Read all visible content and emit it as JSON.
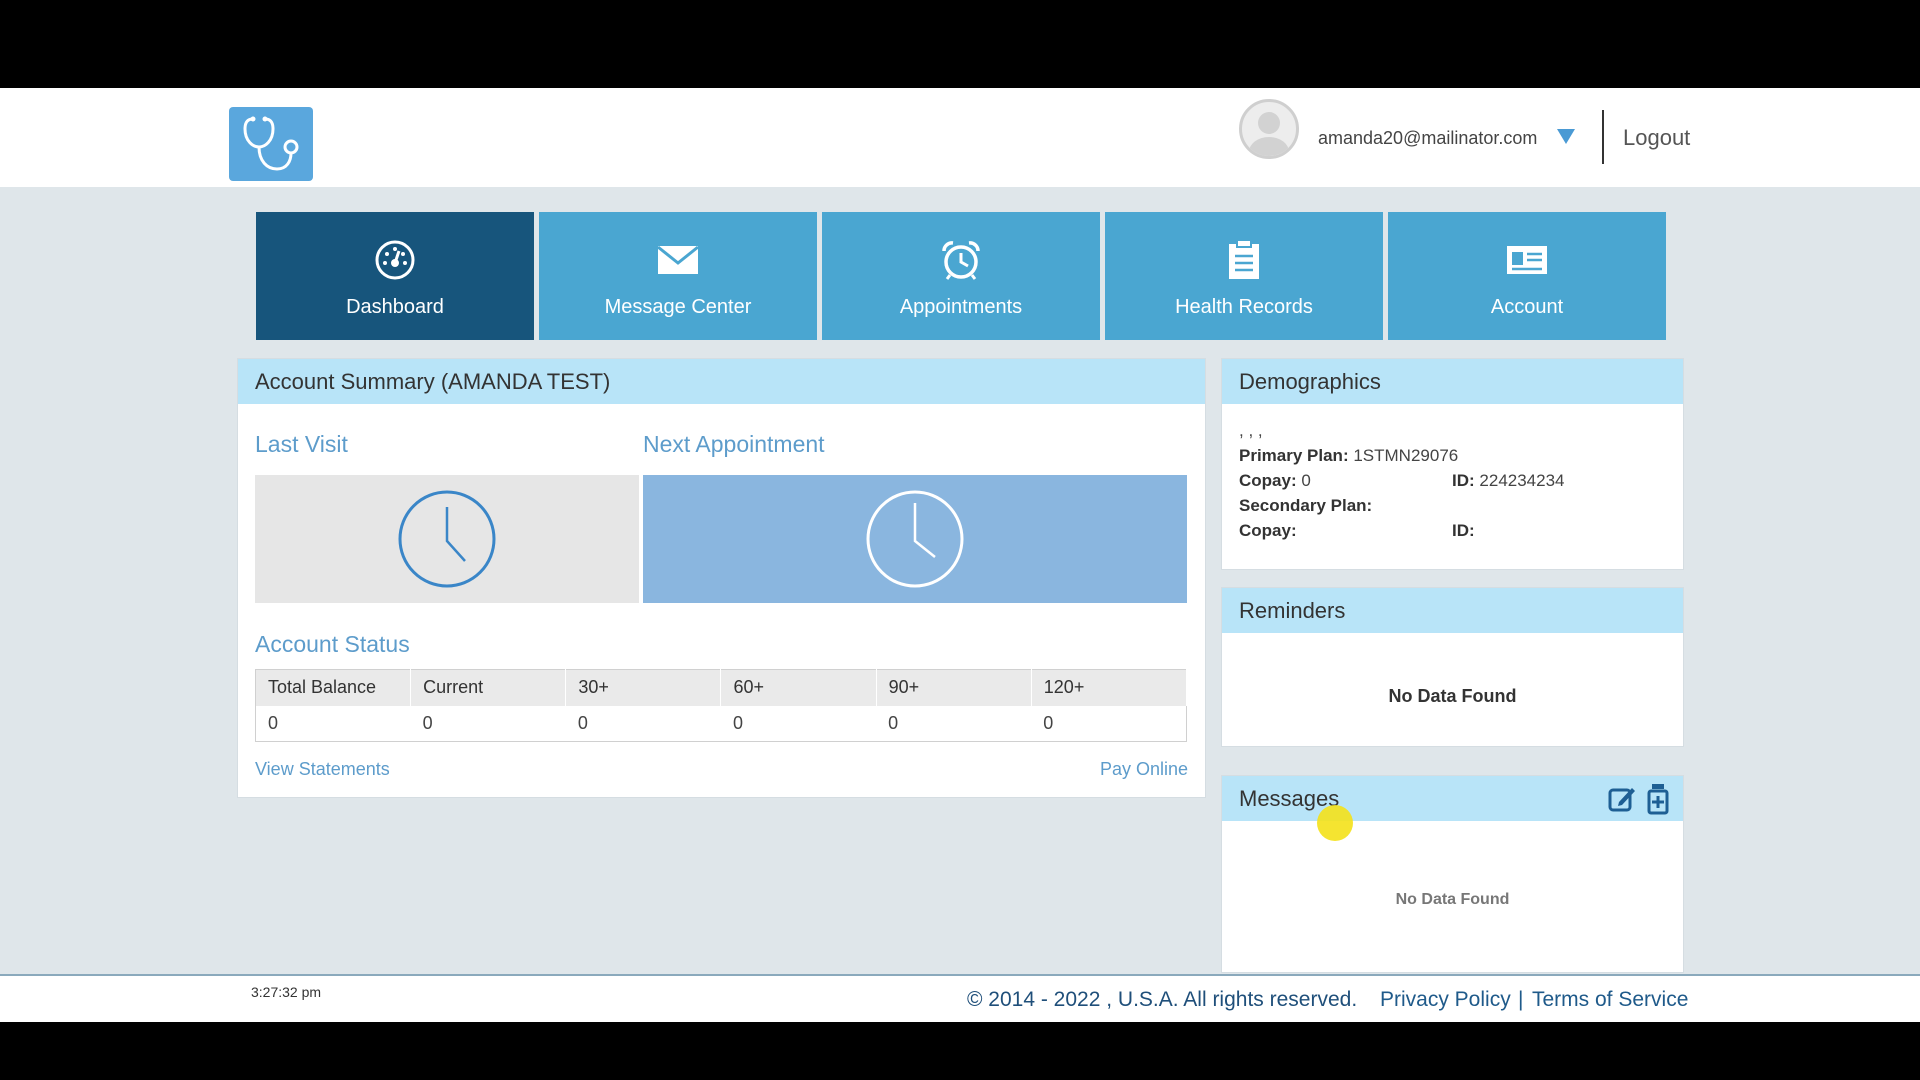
{
  "header": {
    "user_email": "amanda20@mailinator.com",
    "logout_label": "Logout"
  },
  "nav": {
    "tiles": [
      {
        "label": "Dashboard",
        "icon": "dashboard-gauge-icon",
        "active": true
      },
      {
        "label": "Message Center",
        "icon": "envelope-icon"
      },
      {
        "label": "Appointments",
        "icon": "alarm-clock-icon"
      },
      {
        "label": "Health Records",
        "icon": "clipboard-icon"
      },
      {
        "label": "Account",
        "icon": "id-card-icon"
      }
    ]
  },
  "account_summary": {
    "title": "Account Summary (AMANDA TEST)",
    "last_visit_label": "Last Visit",
    "next_appointment_label": "Next Appointment",
    "account_status_label": "Account Status",
    "table": {
      "headers": [
        "Total Balance",
        "Current",
        "30+",
        "60+",
        "90+",
        "120+"
      ],
      "values": [
        "0",
        "0",
        "0",
        "0",
        "0",
        "0"
      ]
    },
    "view_statements_label": "View Statements",
    "pay_online_label": "Pay Online"
  },
  "demographics": {
    "title": "Demographics",
    "name_line": ", , ,",
    "primary_plan_label": "Primary Plan:",
    "primary_plan_value": "1STMN29076",
    "copay_label": "Copay:",
    "copay_value": "0",
    "id_label": "ID:",
    "id_value": "224234234",
    "secondary_plan_label": "Secondary Plan:",
    "copay2_label": "Copay:",
    "id2_label": "ID:"
  },
  "reminders": {
    "title": "Reminders",
    "empty_text": "No Data Found"
  },
  "messages": {
    "title": "Messages",
    "empty_text": "No Data Found"
  },
  "footer": {
    "time": "3:27:32 pm",
    "copyright": "© 2014 - 2022 , U.S.A. All rights reserved.",
    "privacy_label": "Privacy Policy",
    "separator": "|",
    "terms_label": "Terms of Service"
  },
  "colors": {
    "nav_tile": "#4aa6d1",
    "nav_active": "#17557c",
    "panel_header": "#b8e4f8",
    "accent_text": "#5d9ccb"
  }
}
